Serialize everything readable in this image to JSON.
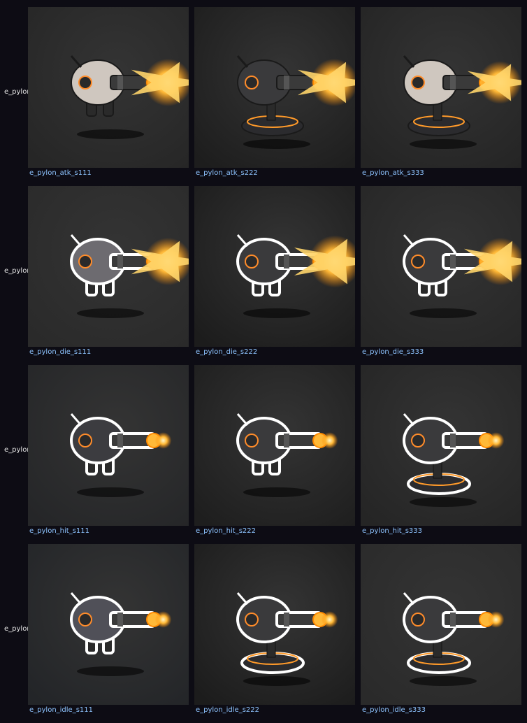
{
  "rows": [
    {
      "label": "e_pylon",
      "cells": [
        {
          "caption": "e_pylon_atk_s111",
          "icon": "pylon-turret-attack-icon"
        },
        {
          "caption": "e_pylon_atk_s222",
          "icon": "pylon-turret-attack-icon"
        },
        {
          "caption": "e_pylon_atk_s333",
          "icon": "pylon-turret-attack-icon"
        }
      ]
    },
    {
      "label": "e_pylon",
      "cells": [
        {
          "caption": "e_pylon_die_s111",
          "icon": "pylon-turret-die-icon"
        },
        {
          "caption": "e_pylon_die_s222",
          "icon": "pylon-turret-die-icon"
        },
        {
          "caption": "e_pylon_die_s333",
          "icon": "pylon-turret-die-icon"
        }
      ]
    },
    {
      "label": "e_pylon",
      "cells": [
        {
          "caption": "e_pylon_hit_s111",
          "icon": "pylon-turret-hit-icon"
        },
        {
          "caption": "e_pylon_hit_s222",
          "icon": "pylon-turret-hit-icon"
        },
        {
          "caption": "e_pylon_hit_s333",
          "icon": "pylon-turret-hit-icon"
        }
      ]
    },
    {
      "label": "e_pylon",
      "cells": [
        {
          "caption": "e_pylon_idle_s111",
          "icon": "pylon-turret-idle-icon"
        },
        {
          "caption": "e_pylon_idle_s222",
          "icon": "pylon-turret-idle-icon"
        },
        {
          "caption": "e_pylon_idle_s333",
          "icon": "pylon-turret-idle-icon"
        }
      ]
    }
  ],
  "colors": {
    "page_background": "#0d0c14",
    "thumbnail_background": "#222222",
    "caption_text": "#8ec4ff",
    "label_text": "#e6e6e6",
    "muzzle_glow": "#ffb938"
  }
}
